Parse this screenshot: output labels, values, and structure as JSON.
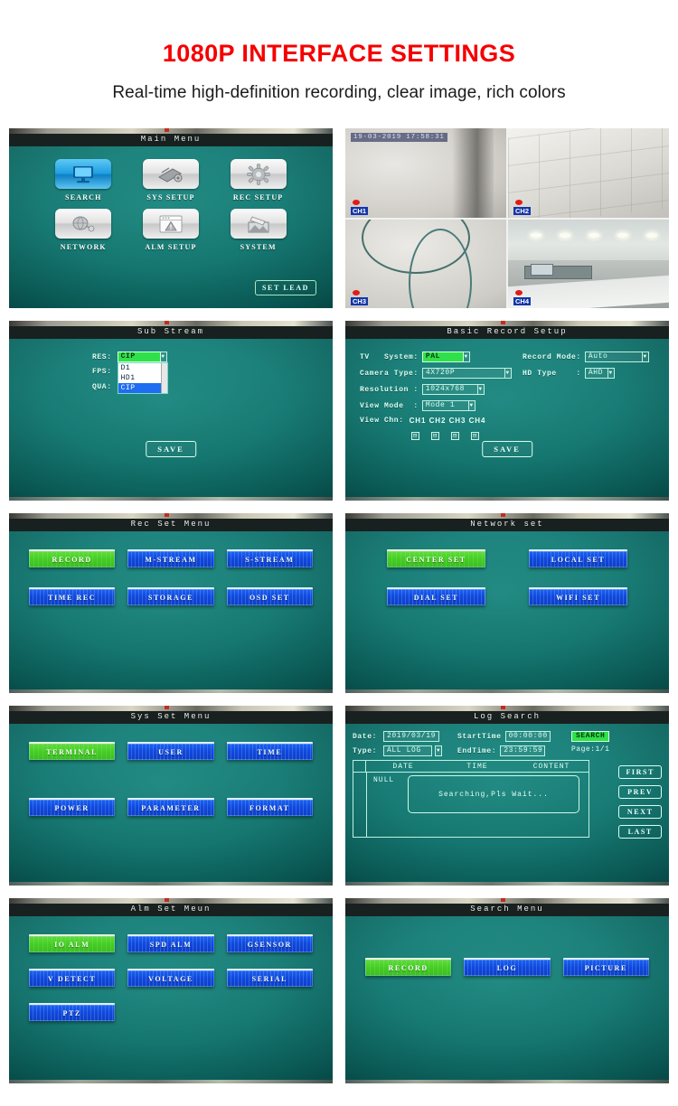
{
  "header": {
    "title": "1080P INTERFACE SETTINGS",
    "subtitle": "Real-time high-definition recording, clear image, rich colors",
    "title_color": "#f50000"
  },
  "theme": {
    "screen_bg": "#0d6b69",
    "button_blue": "#0f49dd",
    "button_green": "#46cf26",
    "highlight_green": "#2ee14a",
    "osd_blue": "#1337a8",
    "rec_red": "#e21b15"
  },
  "panels": {
    "main_menu": {
      "title": "Main Menu",
      "icons": [
        {
          "label": "SEARCH",
          "icon": "monitor-icon",
          "selected": true
        },
        {
          "label": "SYS SETUP",
          "icon": "toolbox-icon",
          "selected": false
        },
        {
          "label": "REC SETUP",
          "icon": "gear-icon",
          "selected": false
        },
        {
          "label": "NETWORK",
          "icon": "globe-net-icon",
          "selected": false
        },
        {
          "label": "ALM SETUP",
          "icon": "warning-icon",
          "selected": false
        },
        {
          "label": "SYSTEM",
          "icon": "picture-icon",
          "selected": false
        }
      ],
      "set_lead_label": "SET LEAD"
    },
    "live_view": {
      "timestamp": "19-03-2019 17:58:31",
      "channels": [
        "CH1",
        "CH2",
        "CH3",
        "CH4"
      ]
    },
    "sub_stream": {
      "title": "Sub Stream",
      "fields": [
        {
          "label": "RES:",
          "value": "CIP"
        },
        {
          "label": "FPS:",
          "value": ""
        },
        {
          "label": "QUA:",
          "value": ""
        }
      ],
      "dropdown_options": [
        "D1",
        "HD1",
        "CIP"
      ],
      "dropdown_selected": "CIP",
      "save_label": "SAVE"
    },
    "basic_record": {
      "title": "Basic Record Setup",
      "left": [
        {
          "label": "TV   System:",
          "value": "PAL",
          "highlight": true
        },
        {
          "label": "Camera Type:",
          "value": "4X720P",
          "highlight": false
        },
        {
          "label": "Resolution :",
          "value": "1024x768",
          "highlight": false
        },
        {
          "label": "View Mode  :",
          "value": "Mode 1",
          "highlight": false
        }
      ],
      "right": [
        {
          "label": "Record Mode:",
          "value": "Auto",
          "highlight": false
        },
        {
          "label": "HD Type    :",
          "value": "AHD",
          "highlight": false
        }
      ],
      "view_chn_label": "View Chn:",
      "view_chn": [
        "CH1",
        "CH2",
        "CH3",
        "CH4"
      ],
      "save_label": "SAVE"
    },
    "rec_set": {
      "title": "Rec Set Menu",
      "buttons": [
        {
          "label": "RECORD",
          "selected": true
        },
        {
          "label": "M-STREAM",
          "selected": false
        },
        {
          "label": "S-STREAM",
          "selected": false
        },
        {
          "label": "TIME REC",
          "selected": false
        },
        {
          "label": "STORAGE",
          "selected": false
        },
        {
          "label": "OSD SET",
          "selected": false
        }
      ]
    },
    "network_set": {
      "title": "Network set",
      "buttons": [
        {
          "label": "CENTER SET",
          "selected": true
        },
        {
          "label": "LOCAL SET",
          "selected": false
        },
        {
          "label": "DIAL SET",
          "selected": false
        },
        {
          "label": "WIFI SET",
          "selected": false
        }
      ]
    },
    "sys_set": {
      "title": "Sys Set Menu",
      "buttons": [
        {
          "label": "TERMINAL",
          "selected": true
        },
        {
          "label": "USER",
          "selected": false
        },
        {
          "label": "TIME",
          "selected": false
        },
        {
          "label": "POWER",
          "selected": false
        },
        {
          "label": "PARAMETER",
          "selected": false
        },
        {
          "label": "FORMAT",
          "selected": false
        }
      ]
    },
    "log_search": {
      "title": "Log Search",
      "date_label": "Date:",
      "date_value": "2019/03/19",
      "type_label": "Type:",
      "type_value": "ALL LOG",
      "start_time_label": "StartTime",
      "start_time_value": "00:00:00",
      "end_time_label": "EndTime:",
      "end_time_value": "23:59:59",
      "search_label": "SEARCH",
      "page_label": "Page:1/1",
      "columns": [
        "DATE",
        "TIME",
        "CONTENT"
      ],
      "empty_text": "NULL",
      "dialog_text": "Searching,Pls Wait...",
      "pager": [
        "FIRST",
        "PREV",
        "NEXT",
        "LAST"
      ]
    },
    "alm_set": {
      "title": "Alm Set Meun",
      "buttons": [
        {
          "label": "IO ALM",
          "selected": true
        },
        {
          "label": "SPD ALM",
          "selected": false
        },
        {
          "label": "GSENSOR",
          "selected": false
        },
        {
          "label": "V DETECT",
          "selected": false
        },
        {
          "label": "VOLTAGE",
          "selected": false
        },
        {
          "label": "SERIAL",
          "selected": false
        },
        {
          "label": "PTZ",
          "selected": false
        }
      ]
    },
    "search_menu": {
      "title": "Search Menu",
      "buttons": [
        {
          "label": "RECORD",
          "selected": true
        },
        {
          "label": "LOG",
          "selected": false
        },
        {
          "label": "PICTURE",
          "selected": false
        }
      ]
    }
  }
}
